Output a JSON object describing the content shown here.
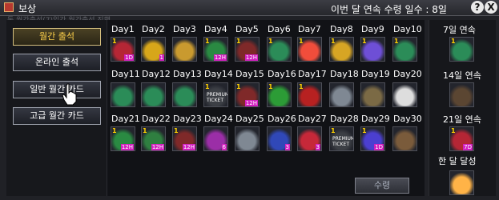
{
  "window": {
    "title": "보상",
    "streak_label": "이번 달 연속 수령 일수 : 8일",
    "help": "?",
    "close": "X",
    "ghost_text": "독 월간출석(7)일간 월간출석 진행"
  },
  "sidebar": {
    "items": [
      {
        "label": "월간 출석",
        "active": true
      },
      {
        "label": "온라인 출석",
        "active": false
      },
      {
        "label": "일반 월간 카드",
        "active": false
      },
      {
        "label": "고급 월간 카드",
        "active": false
      }
    ]
  },
  "days": [
    {
      "label": "Day1",
      "icon": "red-potion",
      "count": "1",
      "badge": "1D"
    },
    {
      "label": "Day2",
      "icon": "gateway-card",
      "count": "",
      "badge": "1"
    },
    {
      "label": "Day3",
      "icon": "gold-key",
      "count": "",
      "badge": ""
    },
    {
      "label": "Day4",
      "icon": "exp-potion-x3",
      "count": "1",
      "badge": "12H"
    },
    {
      "label": "Day5",
      "icon": "exp-potion-30",
      "count": "1",
      "badge": "12H"
    },
    {
      "label": "Day6",
      "icon": "got-potion",
      "count": "1",
      "badge": ""
    },
    {
      "label": "Day7",
      "icon": "rainbow-shield",
      "count": "1",
      "badge": ""
    },
    {
      "label": "Day8",
      "icon": "gold-got-potion",
      "count": "1",
      "badge": ""
    },
    {
      "label": "Day9",
      "icon": "rainbow-got",
      "count": "1",
      "badge": ""
    },
    {
      "label": "Day10",
      "icon": "got-potion",
      "count": "1",
      "badge": ""
    },
    {
      "label": "Day11",
      "icon": "got-potion",
      "count": "",
      "badge": ""
    },
    {
      "label": "Day12",
      "icon": "got-potion",
      "count": "",
      "badge": ""
    },
    {
      "label": "Day13",
      "icon": "got-potion",
      "count": "",
      "badge": ""
    },
    {
      "label": "Day14",
      "icon": "premium-ticket",
      "count": "1",
      "ticket": "PREMIUM TICKET",
      "badge": ""
    },
    {
      "label": "Day15",
      "icon": "exp-potion-30",
      "count": "1",
      "badge": "12H"
    },
    {
      "label": "Day16",
      "icon": "green-capsule",
      "count": "1",
      "badge": ""
    },
    {
      "label": "Day17",
      "icon": "red-tube",
      "count": "1",
      "badge": ""
    },
    {
      "label": "Day18",
      "icon": "silver-shield",
      "count": "",
      "badge": ""
    },
    {
      "label": "Day19",
      "icon": "backpack",
      "count": "",
      "badge": ""
    },
    {
      "label": "Day20",
      "icon": "tshirt",
      "count": "",
      "badge": ""
    },
    {
      "label": "Day21",
      "icon": "exp-potion-x3",
      "count": "1",
      "badge": "12H"
    },
    {
      "label": "Day22",
      "icon": "exp-potion",
      "count": "1",
      "badge": "12H"
    },
    {
      "label": "Day23",
      "icon": "exp-potion-30",
      "count": "1",
      "badge": "12H"
    },
    {
      "label": "Day24",
      "icon": "purple-capsule",
      "count": "",
      "badge": "6"
    },
    {
      "label": "Day25",
      "icon": "silver-shield",
      "count": "",
      "badge": ""
    },
    {
      "label": "Day26",
      "icon": "blue-capsule",
      "count": "",
      "badge": "3"
    },
    {
      "label": "Day27",
      "icon": "red-capsule",
      "count": "",
      "badge": "3"
    },
    {
      "label": "Day28",
      "icon": "premium-ticket",
      "count": "1",
      "ticket": "PREMIUM TICKET",
      "badge": ""
    },
    {
      "label": "Day29",
      "icon": "blue-potion",
      "count": "1",
      "badge": "1D"
    },
    {
      "label": "Day30",
      "icon": "scroll",
      "count": "",
      "badge": ""
    }
  ],
  "streak_rewards": [
    {
      "label": "7일 연속",
      "icon": "got-potion",
      "count": "1",
      "badge": ""
    },
    {
      "label": "14일 연속",
      "icon": "boots",
      "count": "",
      "badge": ""
    },
    {
      "label": "21일 연속",
      "icon": "red-potion",
      "count": "1",
      "badge": "7D"
    },
    {
      "label": "한 달 달성",
      "icon": "gift-box",
      "count": "",
      "badge": ""
    }
  ],
  "receive_button": "수령",
  "colors": {
    "active_menu": "#ffd24b",
    "count": "#ffd200",
    "badge": "#d21fbf"
  }
}
